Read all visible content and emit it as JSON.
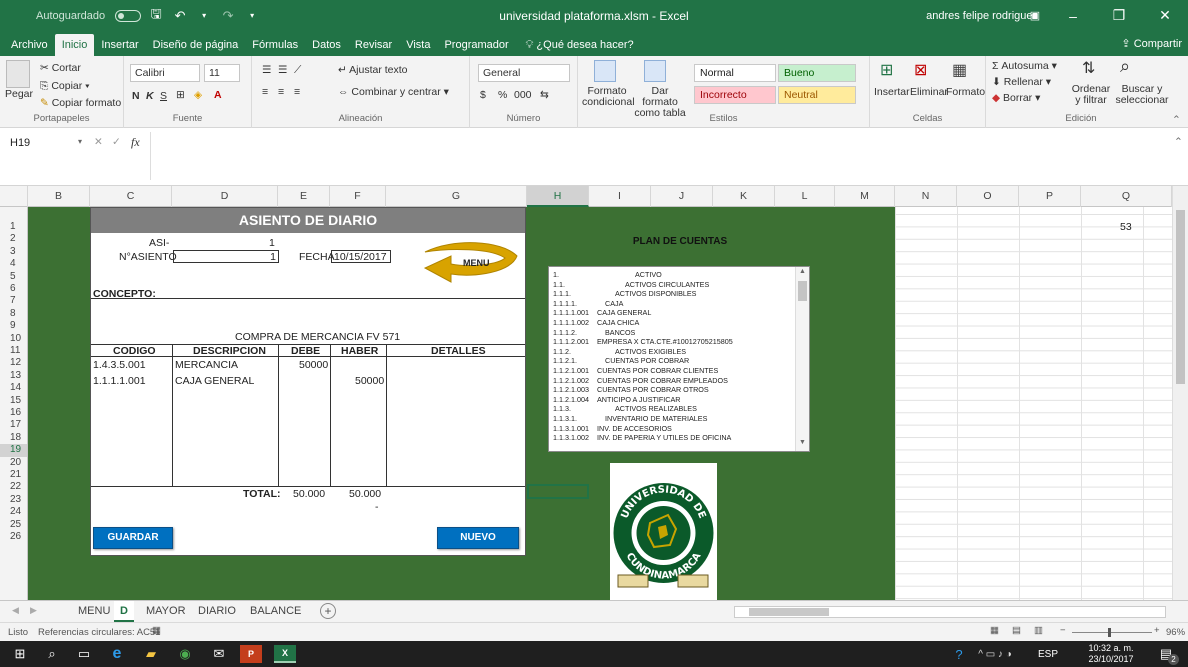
{
  "titlebar": {
    "autosave_label": "Autoguardado",
    "doc_title": "universidad plataforma.xlsm  -  Excel",
    "user_name": "andres felipe rodriguez",
    "minimize": "–",
    "restore": "❐",
    "close": "✕"
  },
  "tabs": [
    "Archivo",
    "Inicio",
    "Insertar",
    "Diseño de página",
    "Fórmulas",
    "Datos",
    "Revisar",
    "Vista",
    "Programador"
  ],
  "tell_me": "¿Qué desea hacer?",
  "share": "Compartir",
  "ribbon": {
    "clipboard": {
      "paste": "Pegar",
      "cut": "Cortar",
      "copy": "Copiar",
      "copy_format": "Copiar formato",
      "label": "Portapapeles"
    },
    "font": {
      "name": "Calibri",
      "size": "11",
      "bold": "N",
      "italic": "K",
      "underline": "S",
      "label": "Fuente"
    },
    "alignment": {
      "wrap": "Ajustar texto",
      "merge": "Combinar y centrar",
      "label": "Alineación"
    },
    "number": {
      "format": "General",
      "currency": "$",
      "percent": "%",
      "thousands": "000",
      "label": "Número"
    },
    "styles": {
      "conditional": "Formato condicional",
      "as_table": "Dar formato como tabla",
      "normal": "Normal",
      "bueno": "Bueno",
      "incorrecto": "Incorrecto",
      "neutral": "Neutral",
      "label": "Estilos"
    },
    "cells": {
      "insert": "Insertar",
      "delete": "Eliminar",
      "format": "Formato",
      "label": "Celdas"
    },
    "editing": {
      "autosum": "Autosuma",
      "fill": "Rellenar",
      "clear": "Borrar",
      "sort": "Ordenar y filtrar",
      "find": "Buscar y seleccionar",
      "label": "Edición"
    }
  },
  "formula_bar": {
    "name_box": "H19",
    "fx": "fx",
    "value": ""
  },
  "columns": [
    "B",
    "C",
    "D",
    "E",
    "F",
    "G",
    "H",
    "I",
    "J",
    "K",
    "L",
    "M",
    "N",
    "O",
    "P",
    "Q"
  ],
  "rows": [
    "1",
    "2",
    "3",
    "4",
    "5",
    "6",
    "7",
    "8",
    "9",
    "10",
    "11",
    "12",
    "13",
    "14",
    "15",
    "16",
    "17",
    "18",
    "19",
    "20",
    "21",
    "22",
    "23",
    "24",
    "25",
    "26"
  ],
  "selected_cell": {
    "col": "H",
    "row": "19"
  },
  "q_value": "53",
  "form": {
    "title": "ASIENTO DE DIARIO",
    "asi_label": "ASI-",
    "asi_value": "1",
    "nasiento_label": "N°ASIENTO",
    "nasiento_value": "1",
    "fecha_label": "FECHA",
    "fecha_value": "10/15/2017",
    "menu_label": "MENU",
    "concepto_label": "CONCEPTO:",
    "concepto_value": "COMPRA DE MERCANCIA FV 571",
    "headers": {
      "codigo": "CODIGO",
      "descripcion": "DESCRIPCION",
      "debe": "DEBE",
      "haber": "HABER",
      "detalles": "DETALLES"
    },
    "rows": [
      {
        "codigo": "1.4.3.5.001",
        "descripcion": "MERCANCIA",
        "debe": "50000",
        "haber": ""
      },
      {
        "codigo": "1.1.1.1.001",
        "descripcion": "CAJA GENERAL",
        "debe": "",
        "haber": "50000"
      }
    ],
    "total_label": "TOTAL:",
    "total_debe": "50.000",
    "total_haber": "50.000",
    "dash": "-",
    "guardar": "GUARDAR",
    "nuevo": "NUEVO"
  },
  "plan": {
    "title": "PLAN DE CUENTAS",
    "items": [
      {
        "code": "1.",
        "name": "ACTIVO"
      },
      {
        "code": "1.1.",
        "name": "ACTIVOS CIRCULANTES"
      },
      {
        "code": "1.1.1.",
        "name": "ACTIVOS DISPONIBLES"
      },
      {
        "code": "1.1.1.1.",
        "name": "CAJA"
      },
      {
        "code": "1.1.1.1.001",
        "name": "CAJA GENERAL"
      },
      {
        "code": "1.1.1.1.002",
        "name": "CAJA CHICA"
      },
      {
        "code": "1.1.1.2.",
        "name": "BANCOS"
      },
      {
        "code": "1.1.1.2.001",
        "name": "EMPRESA X  CTA.CTE.#10012705215805"
      },
      {
        "code": "1.1.2.",
        "name": "ACTIVOS EXIGIBLES"
      },
      {
        "code": "1.1.2.1.",
        "name": "CUENTAS POR COBRAR"
      },
      {
        "code": "1.1.2.1.001",
        "name": "CUENTAS POR COBRAR CLIENTES"
      },
      {
        "code": "1.1.2.1.002",
        "name": "CUENTAS POR COBRAR EMPLEADOS"
      },
      {
        "code": "1.1.2.1.003",
        "name": "CUENTAS POR COBRAR OTROS"
      },
      {
        "code": "1.1.2.1.004",
        "name": "ANTICIPO A JUSTIFICAR"
      },
      {
        "code": "1.1.3.",
        "name": "ACTIVOS REALIZABLES"
      },
      {
        "code": "1.1.3.1.",
        "name": "INVENTARIO DE MATERIALES"
      },
      {
        "code": "1.1.3.1.001",
        "name": "INV. DE ACCESORIOS"
      },
      {
        "code": "1.1.3.1.002",
        "name": "INV. DE PAPERIA Y UTILES  DE OFICINA"
      }
    ]
  },
  "seal": {
    "top": "UNIVERSIDAD DE",
    "bottom": "CUNDINAMARCA"
  },
  "sheet_tabs": [
    "MENU",
    "D",
    "MAYOR",
    "DIARIO",
    "BALANCE"
  ],
  "active_sheet": "D",
  "status": {
    "ready": "Listo",
    "circular": "Referencias circulares: AC51",
    "zoom": "96%"
  },
  "taskbar": {
    "lang": "ESP",
    "time": "10:32 a. m.",
    "date": "23/10/2017",
    "notif": "2"
  }
}
